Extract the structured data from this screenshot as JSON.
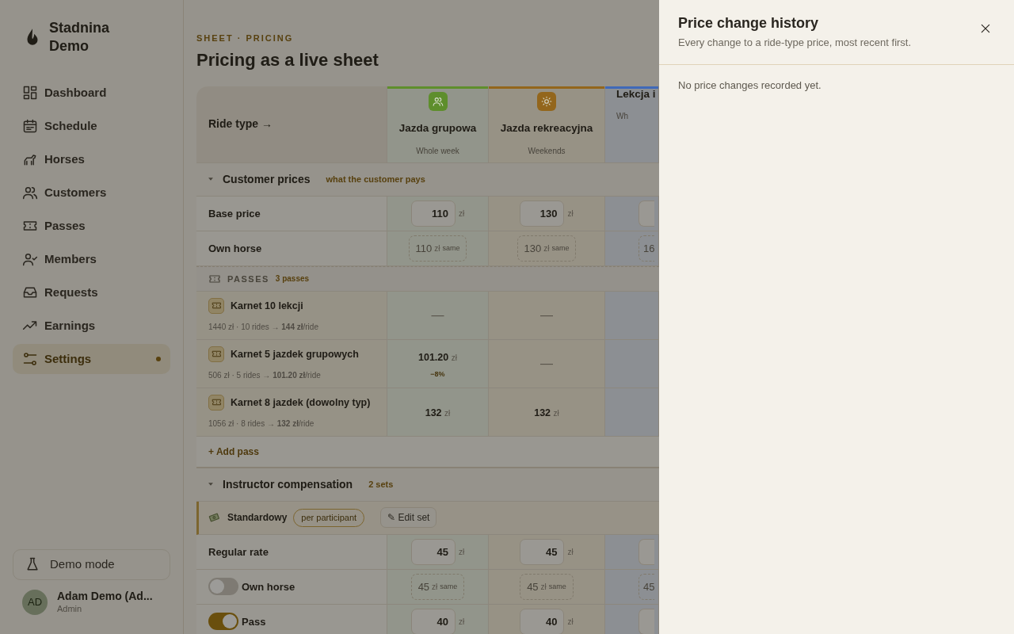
{
  "sidebar": {
    "brand": "Stadnina Demo",
    "items": [
      {
        "label": "Dashboard",
        "selected": false,
        "dot": false
      },
      {
        "label": "Schedule",
        "selected": false,
        "dot": false
      },
      {
        "label": "Horses",
        "selected": false,
        "dot": false
      },
      {
        "label": "Customers",
        "selected": false,
        "dot": false
      },
      {
        "label": "Passes",
        "selected": false,
        "dot": false
      },
      {
        "label": "Members",
        "selected": false,
        "dot": false
      },
      {
        "label": "Requests",
        "selected": false,
        "dot": false
      },
      {
        "label": "Earnings",
        "selected": false,
        "dot": false
      },
      {
        "label": "Settings",
        "selected": true,
        "dot": true
      }
    ],
    "demo_mode": "Demo mode",
    "user": {
      "initials": "AD",
      "name": "Adam Demo (Ad...",
      "role": "Admin"
    }
  },
  "page": {
    "eyebrow": "SHEET · PRICING",
    "title": "Pricing as a live sheet"
  },
  "sheet": {
    "corner": "Ride type →",
    "ride_types": [
      {
        "name": "Jazda grupowa",
        "schedule": "Whole week",
        "color": "#5e8e2c"
      },
      {
        "name": "Jazda rekreacyjna",
        "schedule": "Weekends",
        "color": "#93661c"
      },
      {
        "name": "Lekcja i",
        "schedule": "Wh",
        "color": "#4069b8"
      }
    ],
    "customer_prices": {
      "title": "Customer prices",
      "note": "what the customer pays",
      "expanded": true,
      "rows": [
        {
          "label": "Base price",
          "cells": [
            {
              "kind": "input",
              "value": "110",
              "unit": "zł"
            },
            {
              "kind": "input",
              "value": "130",
              "unit": "zł"
            },
            {
              "kind": "input"
            }
          ]
        },
        {
          "label": "Own horse",
          "cells": [
            {
              "kind": "inherited",
              "value": "110",
              "unit": "zł",
              "note": "same"
            },
            {
              "kind": "inherited",
              "value": "130",
              "unit": "zł",
              "note": "same"
            },
            {
              "kind": "inherited",
              "value": "16"
            }
          ]
        }
      ]
    },
    "passes": {
      "title": "PASSES",
      "count": "3 passes",
      "items": [
        {
          "name": "Karnet 10 lekcji",
          "summary": "1440 zł · 10 rides → **144 zł**/ride",
          "cells": [
            {
              "kind": "none",
              "value": "—"
            },
            {
              "kind": "none",
              "value": "—"
            }
          ]
        },
        {
          "name": "Karnet 5 jazdek grupowych",
          "summary": "506 zł · 5 rides → **101.20 zł**/ride",
          "cells": [
            {
              "kind": "price",
              "value": "101.20",
              "unit": "zł",
              "discount": "−8%"
            },
            {
              "kind": "none",
              "value": "—"
            }
          ]
        },
        {
          "name": "Karnet 8 jazdek (dowolny typ)",
          "summary": "1056 zł · 8 rides → **132 zł**/ride",
          "cells": [
            {
              "kind": "price",
              "value": "132",
              "unit": "zł"
            },
            {
              "kind": "price",
              "value": "132",
              "unit": "zł"
            }
          ]
        }
      ],
      "add": "+ Add pass"
    },
    "instructor": {
      "title": "Instructor compensation",
      "count": "2 sets",
      "expanded": true,
      "set": {
        "name": "Standardowy",
        "tag": "per participant",
        "edit": "✎ Edit set"
      },
      "rows": [
        {
          "label": "Regular rate",
          "cells": [
            {
              "kind": "input",
              "value": "45",
              "unit": "zł"
            },
            {
              "kind": "input",
              "value": "45",
              "unit": "zł"
            },
            {
              "kind": "input"
            }
          ]
        },
        {
          "label": "Own horse",
          "on": false,
          "cells": [
            {
              "kind": "inherited",
              "value": "45",
              "unit": "zł",
              "note": "same"
            },
            {
              "kind": "inherited",
              "value": "45",
              "unit": "zł",
              "note": "same"
            },
            {
              "kind": "inherited",
              "value": "45"
            }
          ]
        },
        {
          "label": "Pass",
          "on": true,
          "cells": [
            {
              "kind": "input",
              "value": "40",
              "unit": "zł"
            },
            {
              "kind": "input",
              "value": "40",
              "unit": "zł"
            },
            {
              "kind": "input"
            }
          ]
        }
      ]
    }
  },
  "drawer": {
    "title": "Price change history",
    "subtitle": "Every change to a ride-type price, most recent first.",
    "empty": "No price changes recorded yet."
  }
}
